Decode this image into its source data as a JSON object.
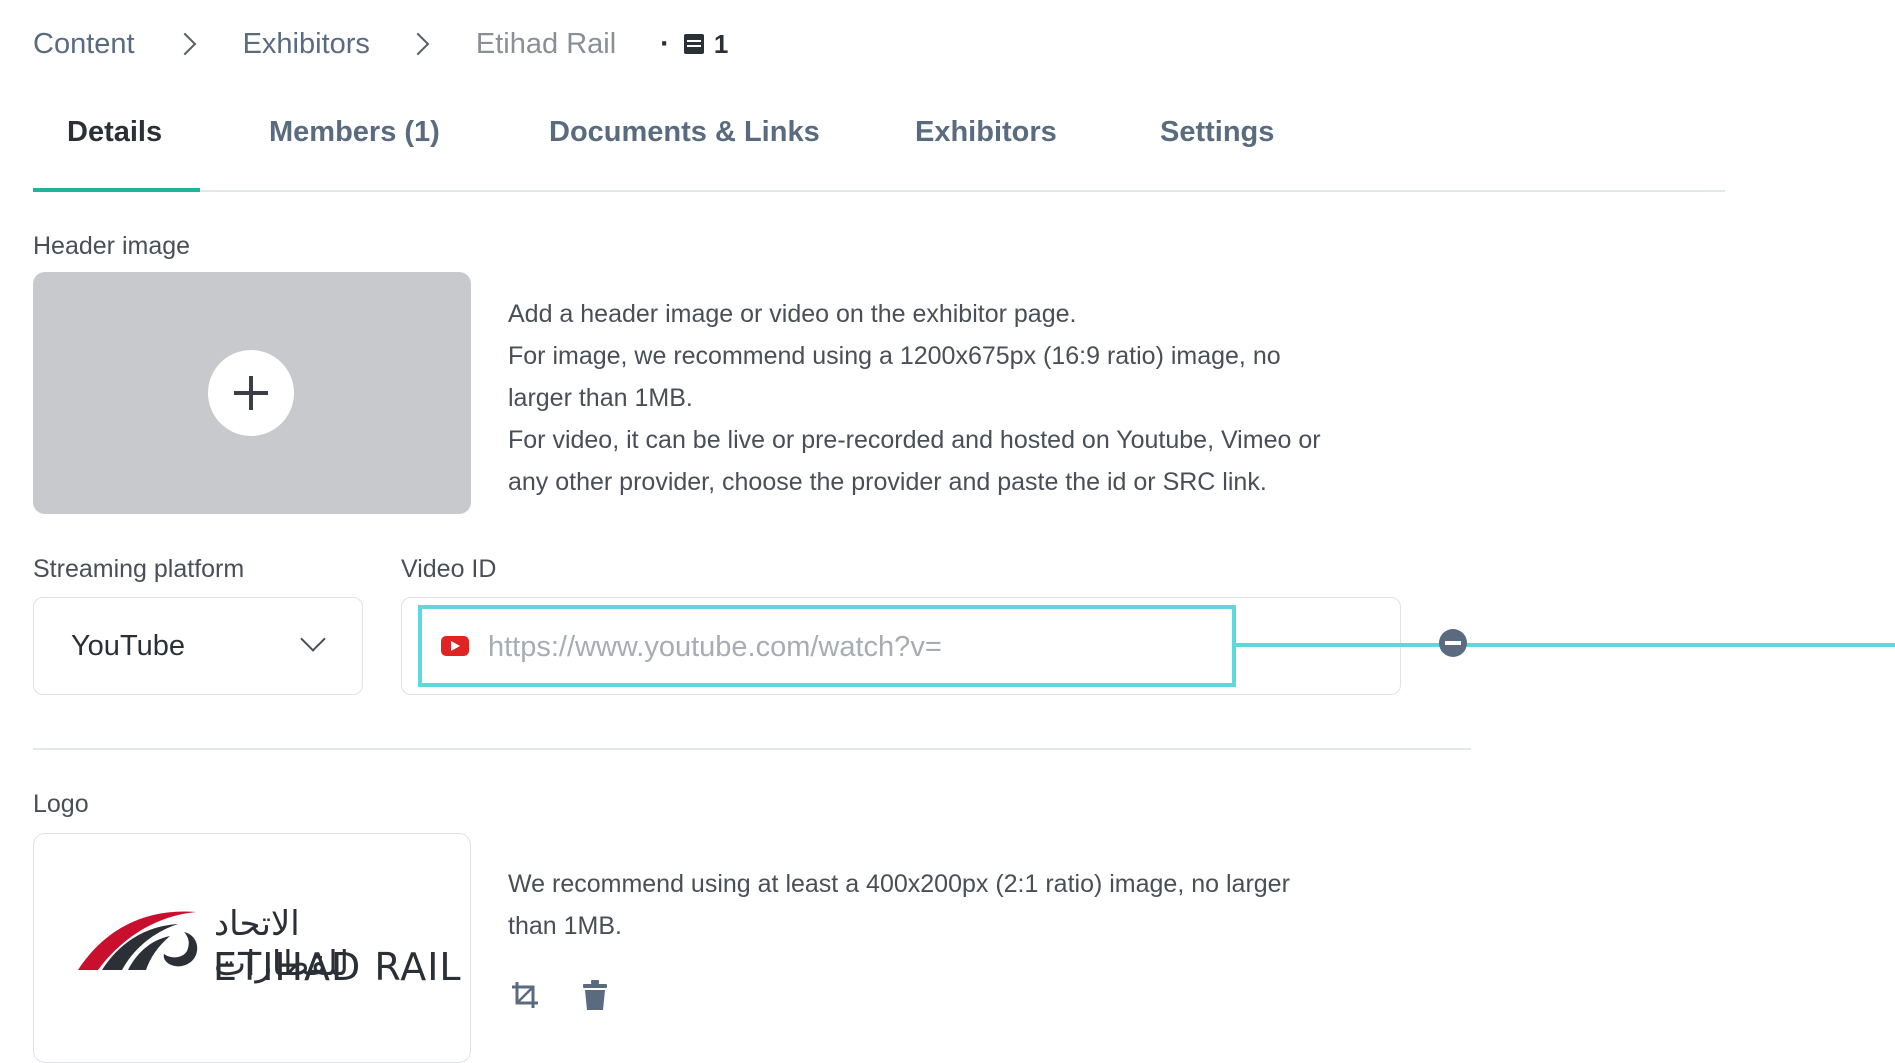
{
  "breadcrumb": {
    "items": [
      "Content",
      "Exhibitors"
    ],
    "current": "Etihad Rail",
    "separator_dot": "·",
    "count": "1"
  },
  "tabs": [
    {
      "label": "Details",
      "active": true
    },
    {
      "label": "Members (1)",
      "active": false
    },
    {
      "label": "Documents & Links",
      "active": false
    },
    {
      "label": "Exhibitors",
      "active": false
    },
    {
      "label": "Settings",
      "active": false
    }
  ],
  "header_image": {
    "label": "Header image",
    "description": [
      "Add a header image or video on the exhibitor page.",
      "For image, we recommend using a 1200x675px (16:9 ratio) image, no",
      "larger than 1MB.",
      "For video, it can be live or pre-recorded and hosted on Youtube, Vimeo or",
      "any other provider, choose the provider and paste the id or SRC link."
    ]
  },
  "streaming_platform": {
    "label": "Streaming platform",
    "value": "YouTube"
  },
  "video_id": {
    "label": "Video ID",
    "value": "",
    "placeholder": "https://www.youtube.com/watch?v="
  },
  "logo": {
    "label": "Logo",
    "arabic_text": "الاتحاد للقطارات",
    "latin_text": "ETIHAD RAIL",
    "description": [
      "We recommend using at least a 400x200px (2:1 ratio) image, no larger",
      "than 1MB."
    ]
  },
  "colors": {
    "accent_teal": "#1fb39a",
    "highlight_cyan": "#5ed8dc",
    "youtube_red": "#e02424",
    "logo_red": "#c8102e"
  },
  "icons": {
    "count": "list-icon",
    "add": "plus-icon",
    "platform": "youtube-icon",
    "info": "info-icon",
    "crop": "crop-icon",
    "delete": "trash-icon"
  }
}
